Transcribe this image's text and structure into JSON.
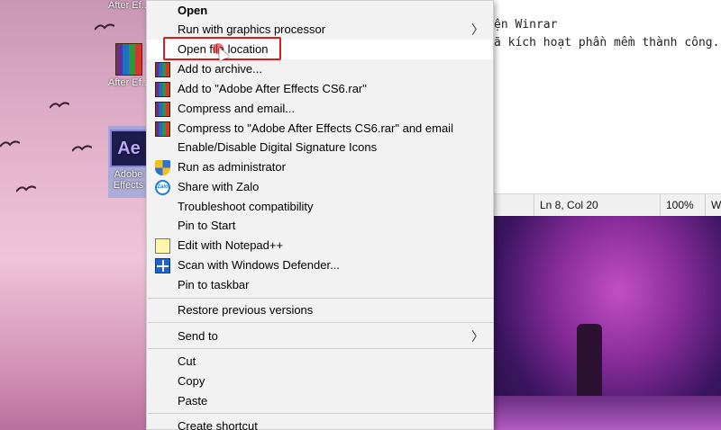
{
  "desktop": {
    "icons": [
      {
        "label": "After Ef...",
        "icon": "winrar-icon"
      },
      {
        "label": "After Ef...",
        "icon": "winrar-icon"
      },
      {
        "label": "Adobe\nEffects",
        "icon": "after-effects-icon"
      }
    ],
    "ae_tile_text": "Ae"
  },
  "notepad": {
    "lines": [
      "ện Winrar",
      "ã kích hoạt phần mềm thành công."
    ],
    "status": {
      "position": "Ln 8, Col 20",
      "zoom": "100%",
      "encoding": "Wi"
    }
  },
  "context_menu": {
    "items": [
      {
        "label": "Open",
        "icon": "",
        "bold": true
      },
      {
        "label": "Run with graphics processor",
        "icon": "",
        "submenu": true
      },
      {
        "label": "Open file location",
        "icon": "",
        "hover": true,
        "highlighted": true
      },
      {
        "label": "Add to archive...",
        "icon": "winrar-icon"
      },
      {
        "label": "Add to \"Adobe After Effects CS6.rar\"",
        "icon": "winrar-icon"
      },
      {
        "label": "Compress and email...",
        "icon": "winrar-icon"
      },
      {
        "label": "Compress to \"Adobe After Effects CS6.rar\" and email",
        "icon": "winrar-icon"
      },
      {
        "label": "Enable/Disable Digital Signature Icons",
        "icon": ""
      },
      {
        "label": "Run as administrator",
        "icon": "uac-shield-icon"
      },
      {
        "label": "Share with Zalo",
        "icon": "zalo-icon"
      },
      {
        "label": "Troubleshoot compatibility",
        "icon": ""
      },
      {
        "label": "Pin to Start",
        "icon": ""
      },
      {
        "label": "Edit with Notepad++",
        "icon": "notepadpp-icon"
      },
      {
        "label": "Scan with Windows Defender...",
        "icon": "defender-icon"
      },
      {
        "label": "Pin to taskbar",
        "icon": ""
      },
      {
        "label": "Restore previous versions",
        "icon": ""
      },
      {
        "label": "Send to",
        "icon": "",
        "submenu": true
      },
      {
        "label": "Cut",
        "icon": ""
      },
      {
        "label": "Copy",
        "icon": ""
      },
      {
        "label": "Paste",
        "icon": ""
      },
      {
        "label": "Create shortcut",
        "icon": ""
      }
    ],
    "chevron": "〉",
    "zalo_text": "Zalo"
  },
  "colors": {
    "highlight_border": "#e0191d",
    "menu_background": "#f2f2f2",
    "menu_hover": "#ffffff"
  }
}
